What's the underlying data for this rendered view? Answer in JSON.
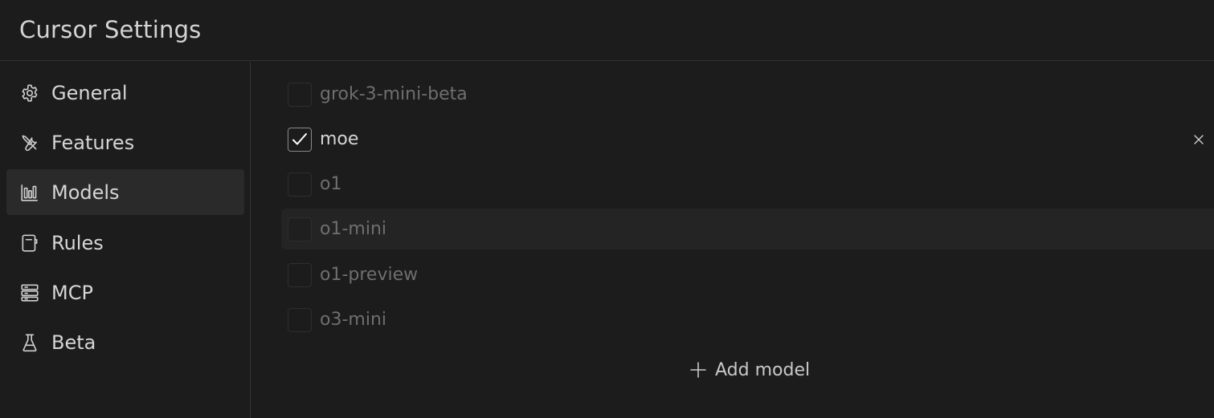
{
  "header": {
    "title": "Cursor Settings"
  },
  "sidebar": {
    "items": [
      {
        "label": "General",
        "icon": "gear-icon",
        "active": false
      },
      {
        "label": "Features",
        "icon": "tools-icon",
        "active": false
      },
      {
        "label": "Models",
        "icon": "bar-chart-icon",
        "active": true
      },
      {
        "label": "Rules",
        "icon": "notebook-icon",
        "active": false
      },
      {
        "label": "MCP",
        "icon": "server-icon",
        "active": false
      },
      {
        "label": "Beta",
        "icon": "flask-icon",
        "active": false
      }
    ]
  },
  "models": {
    "list": [
      {
        "name": "grok-3-mini-beta",
        "checked": false
      },
      {
        "name": "moe",
        "checked": true,
        "removable": true
      },
      {
        "name": "o1",
        "checked": false
      },
      {
        "name": "o1-mini",
        "checked": false,
        "hovered": true
      },
      {
        "name": "o1-preview",
        "checked": false
      },
      {
        "name": "o3-mini",
        "checked": false
      }
    ],
    "add_label": "Add model"
  },
  "colors": {
    "background": "#1c1c1c",
    "active_nav": "#2a2a2a",
    "divider": "#333333",
    "text": "#d6d6d6",
    "muted_text": "#6e6e6e"
  }
}
